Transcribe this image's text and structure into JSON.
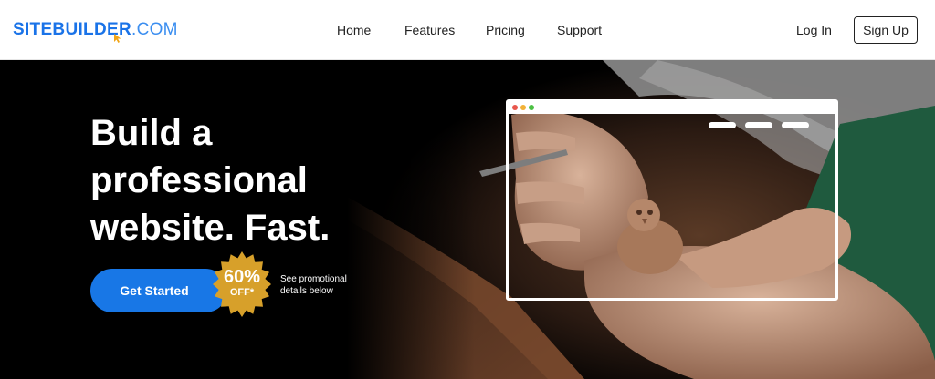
{
  "header": {
    "logo_brand": "SITEBUILDER",
    "logo_tld": ".COM",
    "nav": [
      "Home",
      "Features",
      "Pricing",
      "Support"
    ],
    "login_label": "Log In",
    "signup_label": "Sign Up"
  },
  "hero": {
    "headline_line1": "Build a",
    "headline_line2": "professional",
    "headline_line3": "website. Fast.",
    "cta_label": "Get Started",
    "badge_percent": "60%",
    "badge_off": "OFF*",
    "promo_note": "See promotional details below"
  },
  "colors": {
    "brand_blue": "#1a73e8",
    "cta_blue": "#1877e6",
    "badge_gold": "#d7a02a",
    "hero_bg": "#000000"
  }
}
